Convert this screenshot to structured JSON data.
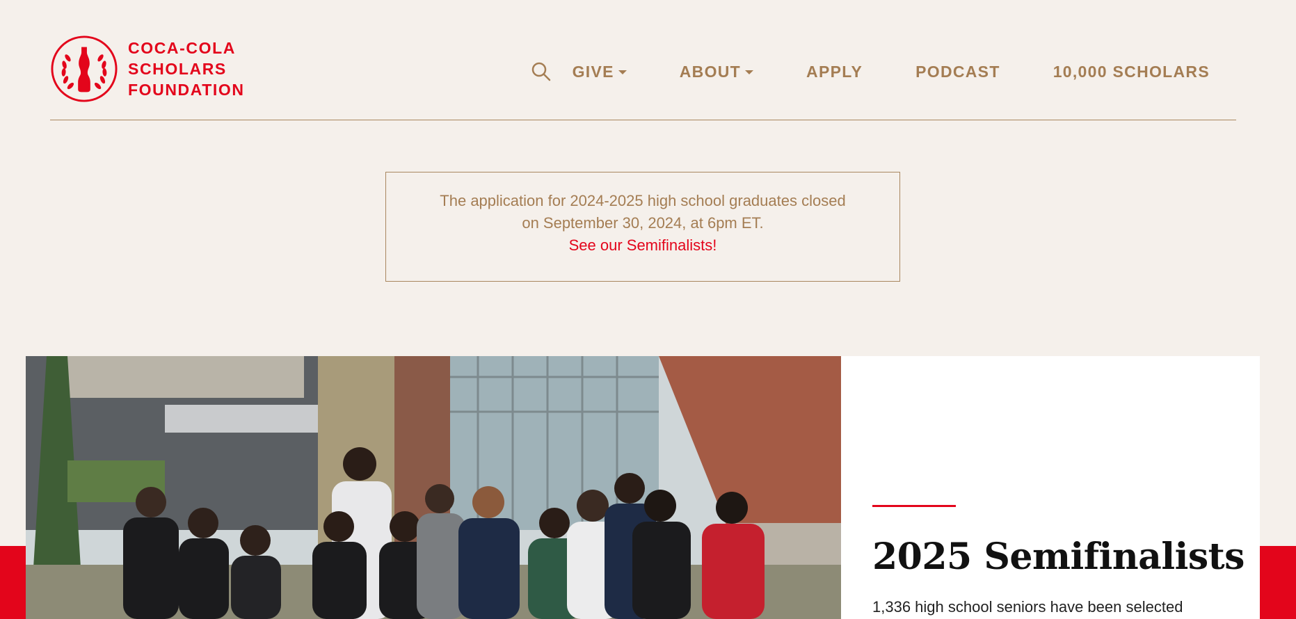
{
  "header": {
    "logo_lines": [
      "COCA-COLA",
      "SCHOLARS",
      "FOUNDATION"
    ],
    "nav": [
      {
        "label": "GIVE",
        "has_dropdown": true
      },
      {
        "label": "ABOUT",
        "has_dropdown": true
      },
      {
        "label": "APPLY",
        "has_dropdown": false
      },
      {
        "label": "PODCAST",
        "has_dropdown": false
      },
      {
        "label": "10,000 SCHOLARS",
        "has_dropdown": false
      }
    ],
    "search_icon": "search-icon"
  },
  "notice": {
    "line1": "The application for 2024-2025 high school graduates closed",
    "line2": "on September 30, 2024, at 6pm ET.",
    "link": "See our Semifinalists!"
  },
  "feature": {
    "title": "2025 Semifinalists",
    "body": "1,336 high school seniors have been selected",
    "photo_alt": "Group of students holding paintbrushes in front of a school building"
  },
  "colors": {
    "accent_red": "#e3051b",
    "brand_tan": "#a47d53",
    "background": "#f5f0eb"
  }
}
